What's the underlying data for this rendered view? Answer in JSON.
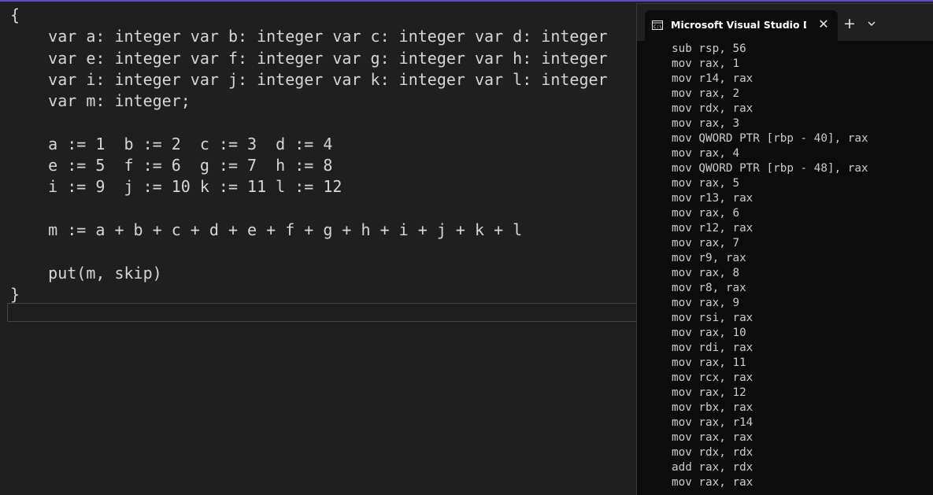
{
  "editor": {
    "lines": [
      "{",
      "    var a: integer var b: integer var c: integer var d: integer",
      "    var e: integer var f: integer var g: integer var h: integer",
      "    var i: integer var j: integer var k: integer var l: integer",
      "    var m: integer;",
      "",
      "    a := 1  b := 2  c := 3  d := 4",
      "    e := 5  f := 6  g := 7  h := 8",
      "    i := 9  j := 10 k := 11 l := 12",
      "",
      "    m := a + b + c + d + e + f + g + h + i + j + k + l",
      "",
      "    put(m, skip)",
      "}"
    ]
  },
  "console": {
    "tab_title": "Microsoft Visual Studio Debug Console",
    "tab_icon": "console-app-icon",
    "close_glyph": "✕",
    "new_tab_glyph": "+",
    "output": [
      "sub rsp, 56",
      "mov rax, 1",
      "mov r14, rax",
      "mov rax, 2",
      "mov rdx, rax",
      "mov rax, 3",
      "mov QWORD PTR [rbp - 40], rax",
      "mov rax, 4",
      "mov QWORD PTR [rbp - 48], rax",
      "mov rax, 5",
      "mov r13, rax",
      "mov rax, 6",
      "mov r12, rax",
      "mov rax, 7",
      "mov r9, rax",
      "mov rax, 8",
      "mov r8, rax",
      "mov rax, 9",
      "mov rsi, rax",
      "mov rax, 10",
      "mov rdi, rax",
      "mov rax, 11",
      "mov rcx, rax",
      "mov rax, 12",
      "mov rbx, rax",
      "mov rax, r14",
      "mov rax, rax",
      "mov rdx, rdx",
      "add rax, rdx",
      "mov rax, rax"
    ]
  },
  "colors": {
    "editor_bg": "#1f1f1f",
    "editor_text": "#d6d6d6",
    "console_bg": "#0c0c0c",
    "console_text": "#cccccc",
    "tabbar_bg": "#202020",
    "accent_line": "#5b4fb0"
  }
}
